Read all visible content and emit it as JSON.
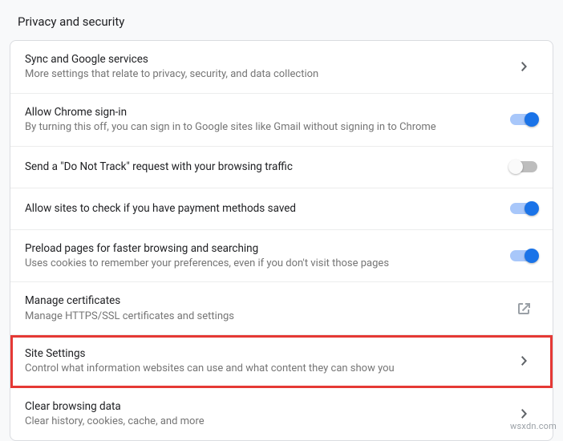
{
  "section_title": "Privacy and security",
  "rows": [
    {
      "title": "Sync and Google services",
      "subtitle": "More settings that relate to privacy, security, and data collection",
      "action": "arrow",
      "name": "sync-google-services"
    },
    {
      "title": "Allow Chrome sign-in",
      "subtitle": "By turning this off, you can sign in to Google sites like Gmail without signing in to Chrome",
      "action": "toggle",
      "on": true,
      "name": "allow-chrome-sign-in"
    },
    {
      "title": "Send a \"Do Not Track\" request with your browsing traffic",
      "subtitle": "",
      "action": "toggle",
      "on": false,
      "name": "do-not-track"
    },
    {
      "title": "Allow sites to check if you have payment methods saved",
      "subtitle": "",
      "action": "toggle",
      "on": true,
      "name": "payment-methods-check"
    },
    {
      "title": "Preload pages for faster browsing and searching",
      "subtitle": "Uses cookies to remember your preferences, even if you don't visit those pages",
      "action": "toggle",
      "on": true,
      "name": "preload-pages"
    },
    {
      "title": "Manage certificates",
      "subtitle": "Manage HTTPS/SSL certificates and settings",
      "action": "external",
      "name": "manage-certificates"
    },
    {
      "title": "Site Settings",
      "subtitle": "Control what information websites can use and what content they can show you",
      "action": "arrow",
      "highlight": true,
      "name": "site-settings"
    },
    {
      "title": "Clear browsing data",
      "subtitle": "Clear history, cookies, cache, and more",
      "action": "arrow",
      "name": "clear-browsing-data"
    }
  ],
  "watermark": "wsxdn.com"
}
